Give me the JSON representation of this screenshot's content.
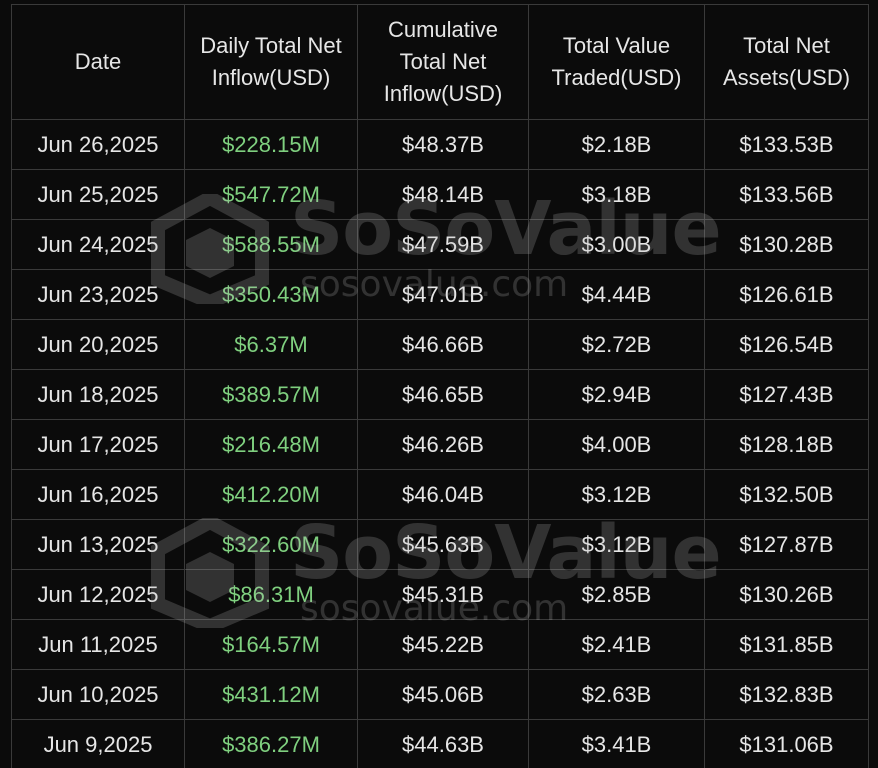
{
  "table": {
    "headers": {
      "date": "Date",
      "daily_flow": "Daily Total Net Inflow(USD)",
      "cumulative_flow": "Cumulative Total Net Inflow(USD)",
      "value_traded": "Total Value Traded(USD)",
      "net_assets": "Total Net Assets(USD)"
    },
    "rows": [
      {
        "date": "Jun 26,2025",
        "daily_flow": "$228.15M",
        "cumulative_flow": "$48.37B",
        "value_traded": "$2.18B",
        "net_assets": "$133.53B"
      },
      {
        "date": "Jun 25,2025",
        "daily_flow": "$547.72M",
        "cumulative_flow": "$48.14B",
        "value_traded": "$3.18B",
        "net_assets": "$133.56B"
      },
      {
        "date": "Jun 24,2025",
        "daily_flow": "$588.55M",
        "cumulative_flow": "$47.59B",
        "value_traded": "$3.00B",
        "net_assets": "$130.28B"
      },
      {
        "date": "Jun 23,2025",
        "daily_flow": "$350.43M",
        "cumulative_flow": "$47.01B",
        "value_traded": "$4.44B",
        "net_assets": "$126.61B"
      },
      {
        "date": "Jun 20,2025",
        "daily_flow": "$6.37M",
        "cumulative_flow": "$46.66B",
        "value_traded": "$2.72B",
        "net_assets": "$126.54B"
      },
      {
        "date": "Jun 18,2025",
        "daily_flow": "$389.57M",
        "cumulative_flow": "$46.65B",
        "value_traded": "$2.94B",
        "net_assets": "$127.43B"
      },
      {
        "date": "Jun 17,2025",
        "daily_flow": "$216.48M",
        "cumulative_flow": "$46.26B",
        "value_traded": "$4.00B",
        "net_assets": "$128.18B"
      },
      {
        "date": "Jun 16,2025",
        "daily_flow": "$412.20M",
        "cumulative_flow": "$46.04B",
        "value_traded": "$3.12B",
        "net_assets": "$132.50B"
      },
      {
        "date": "Jun 13,2025",
        "daily_flow": "$322.60M",
        "cumulative_flow": "$45.63B",
        "value_traded": "$3.12B",
        "net_assets": "$127.87B"
      },
      {
        "date": "Jun 12,2025",
        "daily_flow": "$86.31M",
        "cumulative_flow": "$45.31B",
        "value_traded": "$2.85B",
        "net_assets": "$130.26B"
      },
      {
        "date": "Jun 11,2025",
        "daily_flow": "$164.57M",
        "cumulative_flow": "$45.22B",
        "value_traded": "$2.41B",
        "net_assets": "$131.85B"
      },
      {
        "date": "Jun 10,2025",
        "daily_flow": "$431.12M",
        "cumulative_flow": "$45.06B",
        "value_traded": "$2.63B",
        "net_assets": "$132.83B"
      },
      {
        "date": "Jun 9,2025",
        "daily_flow": "$386.27M",
        "cumulative_flow": "$44.63B",
        "value_traded": "$3.41B",
        "net_assets": "$131.06B"
      }
    ]
  },
  "watermark": {
    "brand": "SoSoValue",
    "url": "sosovalue.com"
  },
  "colors": {
    "background": "#0b0b0b",
    "text": "#e6e6e6",
    "inflow_positive": "#7fd07f",
    "grid_line": "#3a3a3a"
  }
}
